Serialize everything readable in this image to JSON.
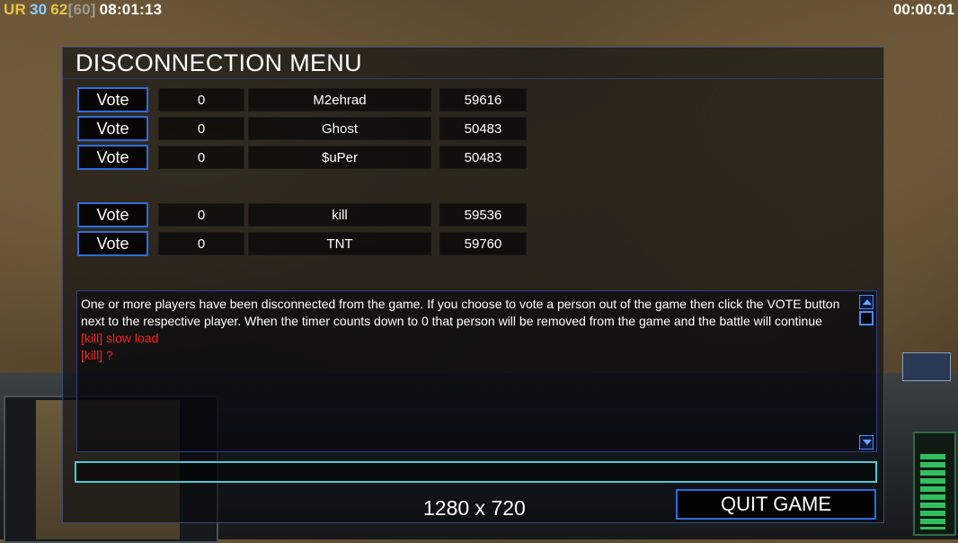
{
  "hud": {
    "ur_label": "UR",
    "fps": "30",
    "lag": "62",
    "lag_max": "[60]",
    "clock": "08:01:13",
    "timer": "00:00:01"
  },
  "dialog": {
    "title": "DISCONNECTION MENU",
    "players": [
      {
        "vote": "Vote",
        "count": "0",
        "name": "M2ehrad",
        "ping": "59616"
      },
      {
        "vote": "Vote",
        "count": "0",
        "name": "Ghost",
        "ping": "50483"
      },
      {
        "vote": "Vote",
        "count": "0",
        "name": "$uPer",
        "ping": "50483"
      },
      {
        "vote": "Vote",
        "count": "0",
        "name": "kill",
        "ping": "59536"
      },
      {
        "vote": "Vote",
        "count": "0",
        "name": "TNT",
        "ping": "59760"
      }
    ],
    "chat": {
      "info": "One or more players have been disconnected from the game. If you choose to vote a person out of the game then click the VOTE button next to the respective player. When the timer counts down to 0 that person will be removed from the game and the battle will continue",
      "messages": [
        "[kill] slow load",
        "[kill] ?"
      ]
    },
    "chat_input_value": "",
    "quit_label": "QUIT GAME",
    "resolution": "1280 x 720"
  },
  "colors": {
    "accent_blue": "#2d6cdb",
    "chat_red": "#ff2020",
    "input_cyan": "#4cc8d8"
  }
}
